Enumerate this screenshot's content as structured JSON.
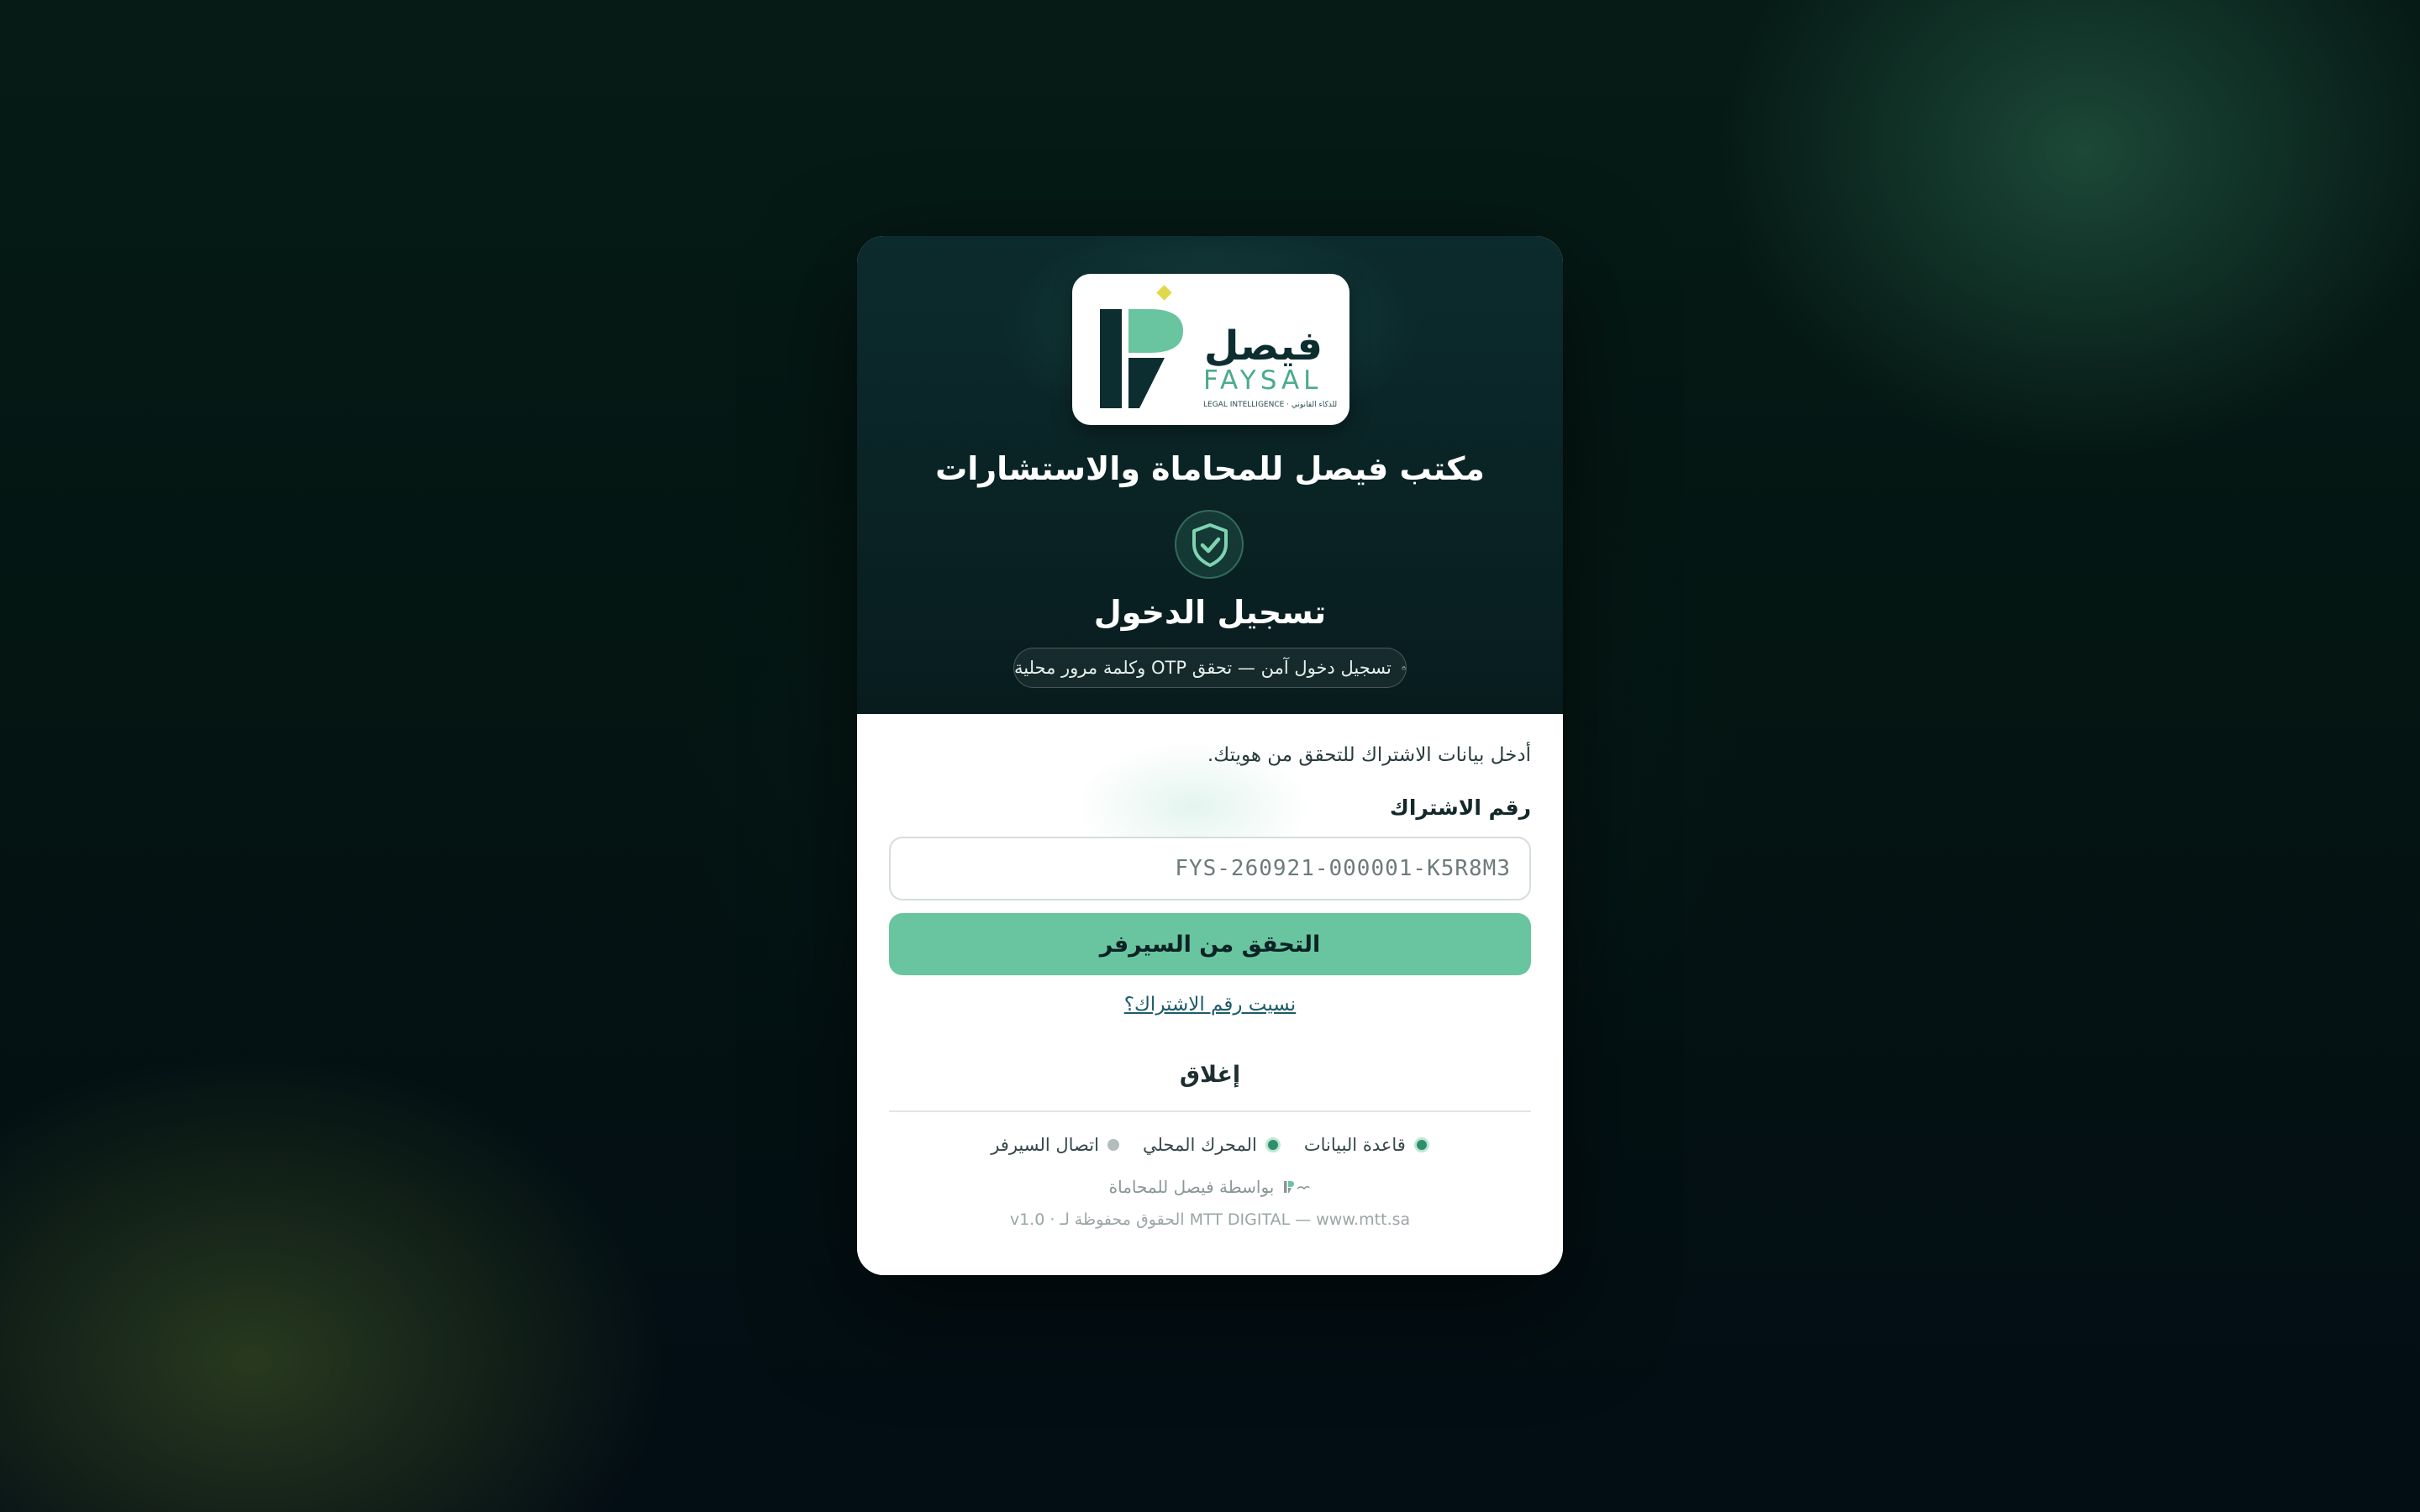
{
  "logo": {
    "arabic_name": "فيصل",
    "latin_name": "FAYSAL",
    "tagline": "LEGAL INTELLIGENCE · للذكاء القانوني"
  },
  "header": {
    "office_name": "مكتب فيصل للمحاماة والاستشارات",
    "login_title": "تسجيل الدخول",
    "secure_notice": "تسجيل دخول آمن — تحقق OTP وكلمة مرور محلية"
  },
  "form": {
    "intro": "أدخل بيانات الاشتراك للتحقق من هويتك.",
    "subscription_label": "رقم الاشتراك",
    "subscription_placeholder": "FYS-260921-000001-K5R8M3",
    "subscription_value": "",
    "verify_button": "التحقق من السيرفر",
    "forgot_link": "نسيت رقم الاشتراك؟",
    "close_button": "إغلاق"
  },
  "status": [
    {
      "label": "قاعدة البيانات",
      "state": "ok"
    },
    {
      "label": "المحرك المحلي",
      "state": "ok"
    },
    {
      "label": "اتصال السيرفر",
      "state": "off"
    }
  ],
  "footer": {
    "powered_by": "بواسطة فيصل للمحاماة",
    "copyright": "MTT DIGITAL — www.mtt.sa الحقوق محفوظة لـ · v1.0"
  },
  "colors": {
    "accent": "#69c4a0",
    "header_bg": "#0a2325",
    "status_ok": "#2f8f6b",
    "status_off": "#b4bcbc",
    "logo_yellow": "#e0d84a"
  },
  "icons": {
    "logo": "faysal-logo-icon",
    "shield": "shield-check-icon",
    "lock": "lock-icon",
    "footer_logo": "faysal-mini-logo-icon"
  }
}
